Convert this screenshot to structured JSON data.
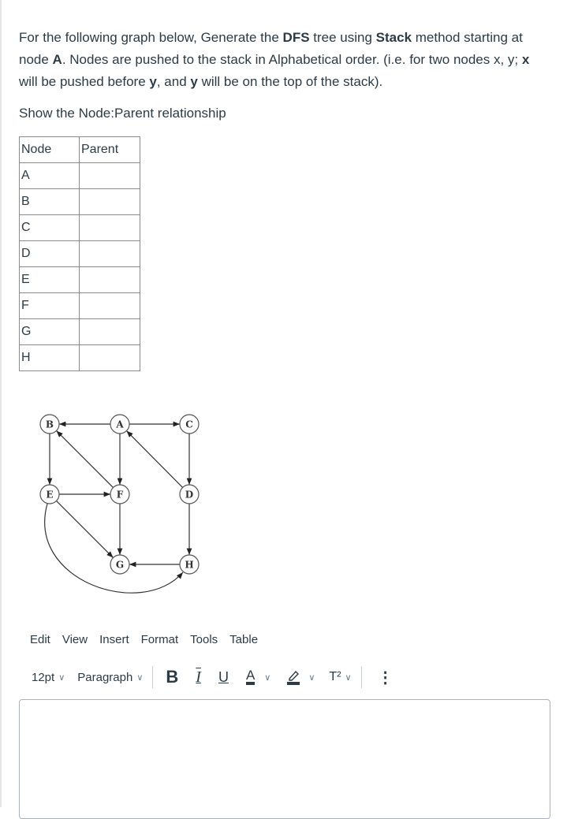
{
  "question": {
    "line1_pre": "For the following graph below, Generate the ",
    "line1_b1": "DFS",
    "line1_mid": " tree using ",
    "line1_b2": "Stack",
    "line1_post": " method starting at node ",
    "line1_b3": "A",
    "line1_tail": ". Nodes are pushed to the stack in Alphabetical order. (i.e.  for two nodes x, y; ",
    "bx": "x",
    "t2": " will be pushed before ",
    "by1": "y",
    "t3": ", and ",
    "by2": "y",
    "t4": " will be on the top of the stack).",
    "subtitle": "Show the Node:Parent relationship"
  },
  "table": {
    "headers": [
      "Node",
      "Parent"
    ],
    "rows": [
      {
        "node": "A",
        "parent": ""
      },
      {
        "node": "B",
        "parent": ""
      },
      {
        "node": "C",
        "parent": ""
      },
      {
        "node": "D",
        "parent": ""
      },
      {
        "node": "E",
        "parent": ""
      },
      {
        "node": "F",
        "parent": ""
      },
      {
        "node": "G",
        "parent": ""
      },
      {
        "node": "H",
        "parent": ""
      }
    ]
  },
  "graph": {
    "nodes": [
      "A",
      "B",
      "C",
      "D",
      "E",
      "F",
      "G",
      "H"
    ],
    "edges": [
      [
        "A",
        "B"
      ],
      [
        "A",
        "C"
      ],
      [
        "A",
        "F"
      ],
      [
        "B",
        "E"
      ],
      [
        "C",
        "D"
      ],
      [
        "D",
        "A"
      ],
      [
        "D",
        "H"
      ],
      [
        "E",
        "F"
      ],
      [
        "E",
        "G"
      ],
      [
        "E",
        "H"
      ],
      [
        "F",
        "B"
      ],
      [
        "F",
        "G"
      ],
      [
        "H",
        "G"
      ]
    ]
  },
  "editor": {
    "menu": [
      "Edit",
      "View",
      "Insert",
      "Format",
      "Tools",
      "Table"
    ],
    "font_size": "12pt",
    "block_format": "Paragraph",
    "bold": "B",
    "italic": "I",
    "underline": "U",
    "text_color": "A",
    "superscript": "T²",
    "more": "⋮",
    "chevron": "∨"
  }
}
